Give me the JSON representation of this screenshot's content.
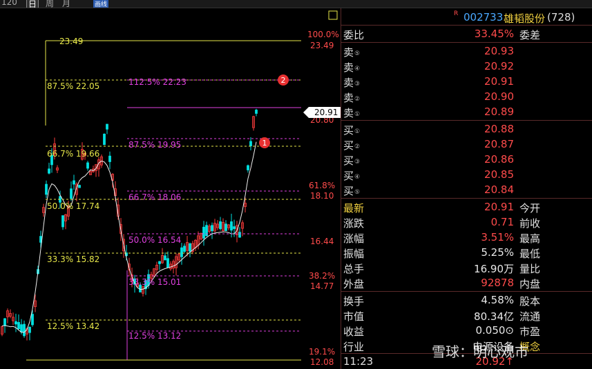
{
  "toolbar": {
    "period": "120",
    "day": "日",
    "week": "周",
    "month": "月",
    "mode": "画线"
  },
  "stock": {
    "marker": "R",
    "code": "002733",
    "name": "雄韬股份",
    "count": "(728)"
  },
  "orderbook": {
    "ratio_label": "委比",
    "ratio_value": "33.45%",
    "diff_label": "委差",
    "sells": [
      {
        "label": "卖",
        "level": "⑤",
        "price": "20.93"
      },
      {
        "label": "卖",
        "level": "④",
        "price": "20.92"
      },
      {
        "label": "卖",
        "level": "③",
        "price": "20.91"
      },
      {
        "label": "卖",
        "level": "②",
        "price": "20.90"
      },
      {
        "label": "卖",
        "level": "①",
        "price": "20.89"
      }
    ],
    "buys": [
      {
        "label": "买",
        "level": "①",
        "price": "20.88"
      },
      {
        "label": "买",
        "level": "②",
        "price": "20.87"
      },
      {
        "label": "买",
        "level": "③",
        "price": "20.86"
      },
      {
        "label": "买",
        "level": "④",
        "price": "20.85"
      },
      {
        "label": "买",
        "level": "⑤",
        "price": "20.84"
      }
    ]
  },
  "quote": {
    "rows": [
      {
        "l": "最新",
        "v": "20.91",
        "r": "今开"
      },
      {
        "l": "涨跌",
        "v": "0.71",
        "r": "前收"
      },
      {
        "l": "涨幅",
        "v": "3.51%",
        "r": "最高"
      },
      {
        "l": "振幅",
        "v": "5.25%",
        "r": "最低"
      },
      {
        "l": "总手",
        "v": "16.90万",
        "r": "量比"
      },
      {
        "l": "外盘",
        "v": "92878",
        "r": "内盘"
      }
    ],
    "rows2": [
      {
        "l": "换手",
        "v": "4.58%",
        "r": "股本"
      },
      {
        "l": "市值",
        "v": "80.34亿",
        "r": "流通"
      },
      {
        "l": "收益",
        "v": "0.050⊙",
        "r": "市盈"
      },
      {
        "l": "行业",
        "v": "电源设备",
        "r": "概念"
      }
    ],
    "time": "11:23",
    "last_price": "20.92↑"
  },
  "chart": {
    "current_price_tag": "20.91",
    "fib_yellow": [
      "23.49",
      "87.5% 22.05",
      "66.7% 19.66",
      "50.0% 17.74",
      "33.3% 15.82",
      "12.5% 13.42"
    ],
    "fib_magenta": [
      "112.5% 22.23",
      "87.5% 19.95",
      "66.7% 18.06",
      "50.0% 16.54",
      "33.3% 15.01",
      "12.5% 13.12"
    ],
    "axis_labels": [
      "100.0%",
      "23.49",
      "20.80",
      "61.8%",
      "18.10",
      "16.44",
      "38.2%",
      "14.77",
      "19.1%",
      "12.08"
    ],
    "markers": [
      "1",
      "2"
    ],
    "colors": {
      "up": "#ff3c3c",
      "down": "#00e0e0",
      "ma": "#f0f0f0",
      "yellow": "#e8e84a",
      "magenta": "#e040e0"
    }
  },
  "watermark": "雪球：明心观市"
}
